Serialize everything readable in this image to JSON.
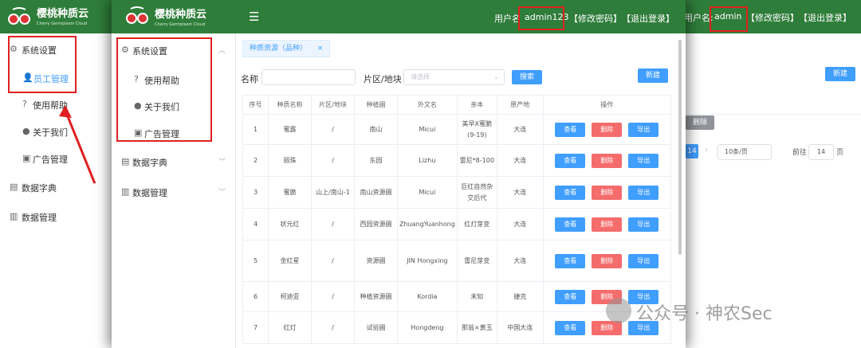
{
  "brand": {
    "name": "樱桃种质云",
    "subtitle": "Cherry Germplasm Cloud"
  },
  "background_window": {
    "header": {
      "user_label": "用户名:",
      "username": "admin",
      "change_password": "【修改密码】",
      "logout": "【退出登录】"
    },
    "sidebar": {
      "system_settings": "系统设置",
      "items": [
        "员工管理",
        "使用帮助",
        "关于我们",
        "广告管理"
      ],
      "data_dictionary": "数据字典",
      "data_management": "数据管理"
    },
    "new_button": "新建",
    "delete_button": "删除",
    "pagination": {
      "current_page": "14",
      "page_size": "10条/页",
      "goto_label": "前往",
      "goto_value": "14",
      "page_suffix": "页"
    }
  },
  "front_window": {
    "header": {
      "user_label": "用户名",
      "username": "admin123",
      "change_password": "【修改密码】",
      "logout": "【退出登录】"
    },
    "sidebar": {
      "system_settings": "系统设置",
      "items": [
        "使用帮助",
        "关于我们",
        "广告管理"
      ],
      "data_dictionary": "数据字典",
      "data_management": "数据管理"
    },
    "tab": {
      "label": "种质资源（品种）",
      "close": "×"
    },
    "filters": {
      "name_label": "名称",
      "name_value": "",
      "region_label": "片区/地块",
      "region_placeholder": "请选择",
      "search_button": "搜索",
      "new_button": "新建"
    },
    "table": {
      "columns": [
        "序号",
        "种质名称",
        "片区/地块",
        "种植圃",
        "外文名",
        "亲本",
        "原产地",
        "操作"
      ],
      "action_labels": {
        "view": "查看",
        "delete": "删除",
        "export": "导出"
      },
      "rows": [
        [
          "1",
          "蜜露",
          "/",
          "南山",
          "Micui",
          "美早X蜜脆(9-19)",
          "大连"
        ],
        [
          "2",
          "丽珠",
          "/",
          "东园",
          "Lizhu",
          "雷尼*8-100",
          "大连"
        ],
        [
          "3",
          "蜜脆",
          "山上/南山-1",
          "南山资源圃",
          "Micui",
          "巨红自然杂交后代",
          "大连"
        ],
        [
          "4",
          "状元红",
          "/",
          "西园资源圃",
          "ZhuangYuanhong",
          "红灯芽变",
          "大连"
        ],
        [
          "5",
          "金红星",
          "/",
          "资源圃",
          "JIN Hongxing",
          "雷尼芽变",
          "大连"
        ],
        [
          "6",
          "柯迪亚",
          "/",
          "种植资源圃",
          "Kordia",
          "未知",
          "捷克"
        ],
        [
          "7",
          "红灯",
          "/",
          "试验圃",
          "Hongdeng",
          "那翁×黄玉",
          "中国大连"
        ]
      ]
    }
  },
  "watermark": "公众号 · 神农Sec",
  "colors": {
    "header_green": "#2f7d3a",
    "primary_blue": "#409eff",
    "danger_red": "#f56c6c",
    "annotation_red": "#e02020"
  }
}
